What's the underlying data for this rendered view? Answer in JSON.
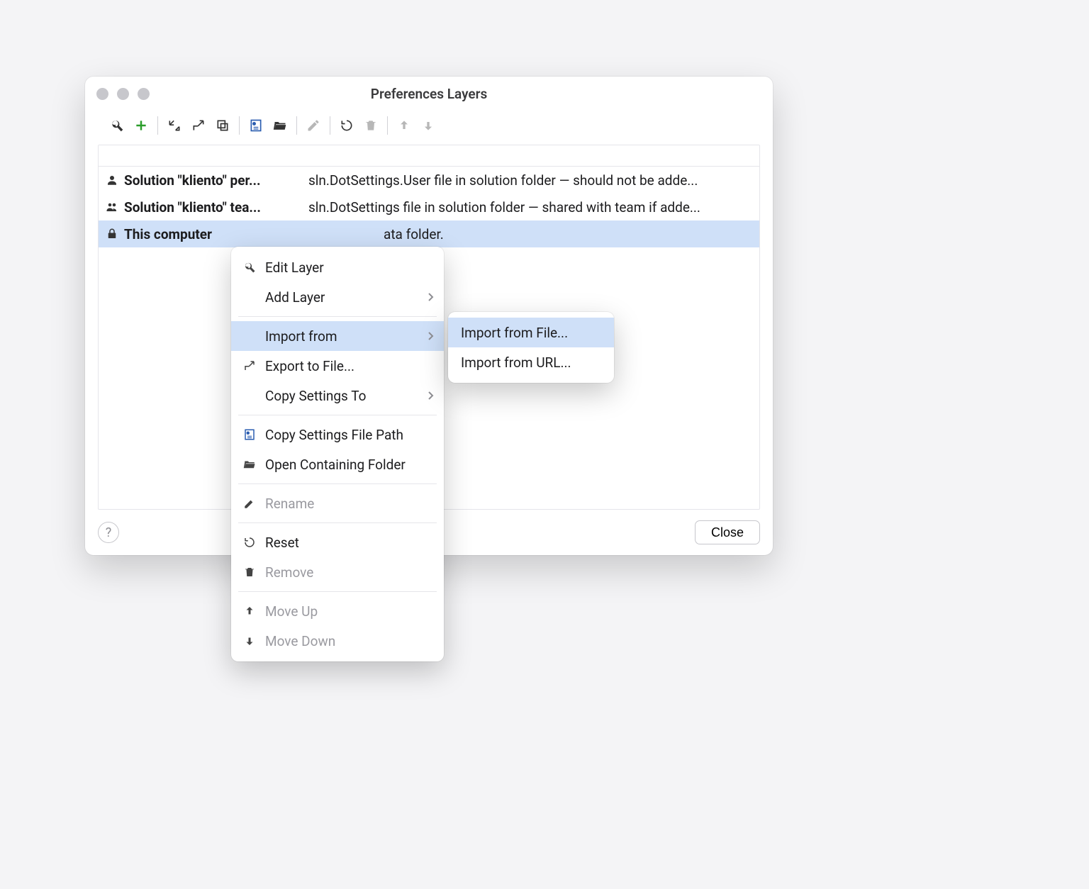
{
  "window": {
    "title": "Preferences Layers"
  },
  "rows": [
    {
      "name": "Solution \"kliento\" per...",
      "desc": "sln.DotSettings.User file in solution folder — should not be adde..."
    },
    {
      "name": "Solution \"kliento\" tea...",
      "desc": "sln.DotSettings file in solution folder — shared with team if adde..."
    },
    {
      "name": "This computer",
      "desc": "ata folder."
    }
  ],
  "menu": {
    "edit": "Edit Layer",
    "add": "Add Layer",
    "import": "Import from",
    "export": "Export to File...",
    "copyto": "Copy Settings To",
    "copypath": "Copy Settings File Path",
    "openfolder": "Open Containing Folder",
    "rename": "Rename",
    "reset": "Reset",
    "remove": "Remove",
    "moveup": "Move Up",
    "movedown": "Move Down"
  },
  "submenu": {
    "file": "Import from File...",
    "url": "Import from URL..."
  },
  "footer": {
    "close": "Close"
  }
}
